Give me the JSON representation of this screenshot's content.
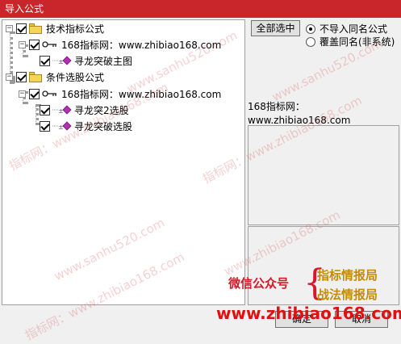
{
  "window": {
    "title": "导入公式"
  },
  "tree": {
    "groups": [
      {
        "label": "技术指标公式",
        "source": "168指标网：www.zhibiao168.com",
        "items": [
          "寻龙突破主图"
        ]
      },
      {
        "label": "条件选股公式",
        "source": "168指标网：www.zhibiao168.com",
        "items": [
          "寻龙突2选股",
          "寻龙突破选股"
        ]
      }
    ]
  },
  "right": {
    "select_all_label": "全部选中",
    "radio_skip_label": "不导入同名公式",
    "radio_overwrite_label": "覆盖同名(非系统)",
    "desc_line1": "168指标网：",
    "desc_line2": "www.zhibiao168.com",
    "ok_label": "确定",
    "cancel_label": "取消"
  },
  "overlay": {
    "wechat_label": "微信公众号",
    "promo_line1": "指标情报局",
    "promo_line2": "战法情报局",
    "big_url": "www.zhibiao168.com",
    "watermarks": [
      "www.sanhu520.com",
      "指标网：www.zhibiao168.com",
      "www.sanhu520.com",
      "指标网：www.zhibiao168.com",
      "www.sanhu520.com",
      "指标网：www.zhibiao168.com",
      "www.zhibiao168.com"
    ]
  },
  "colors": {
    "titlebar": "#c9262b",
    "accent_red": "#d4192a",
    "gold": "#c78b00"
  }
}
